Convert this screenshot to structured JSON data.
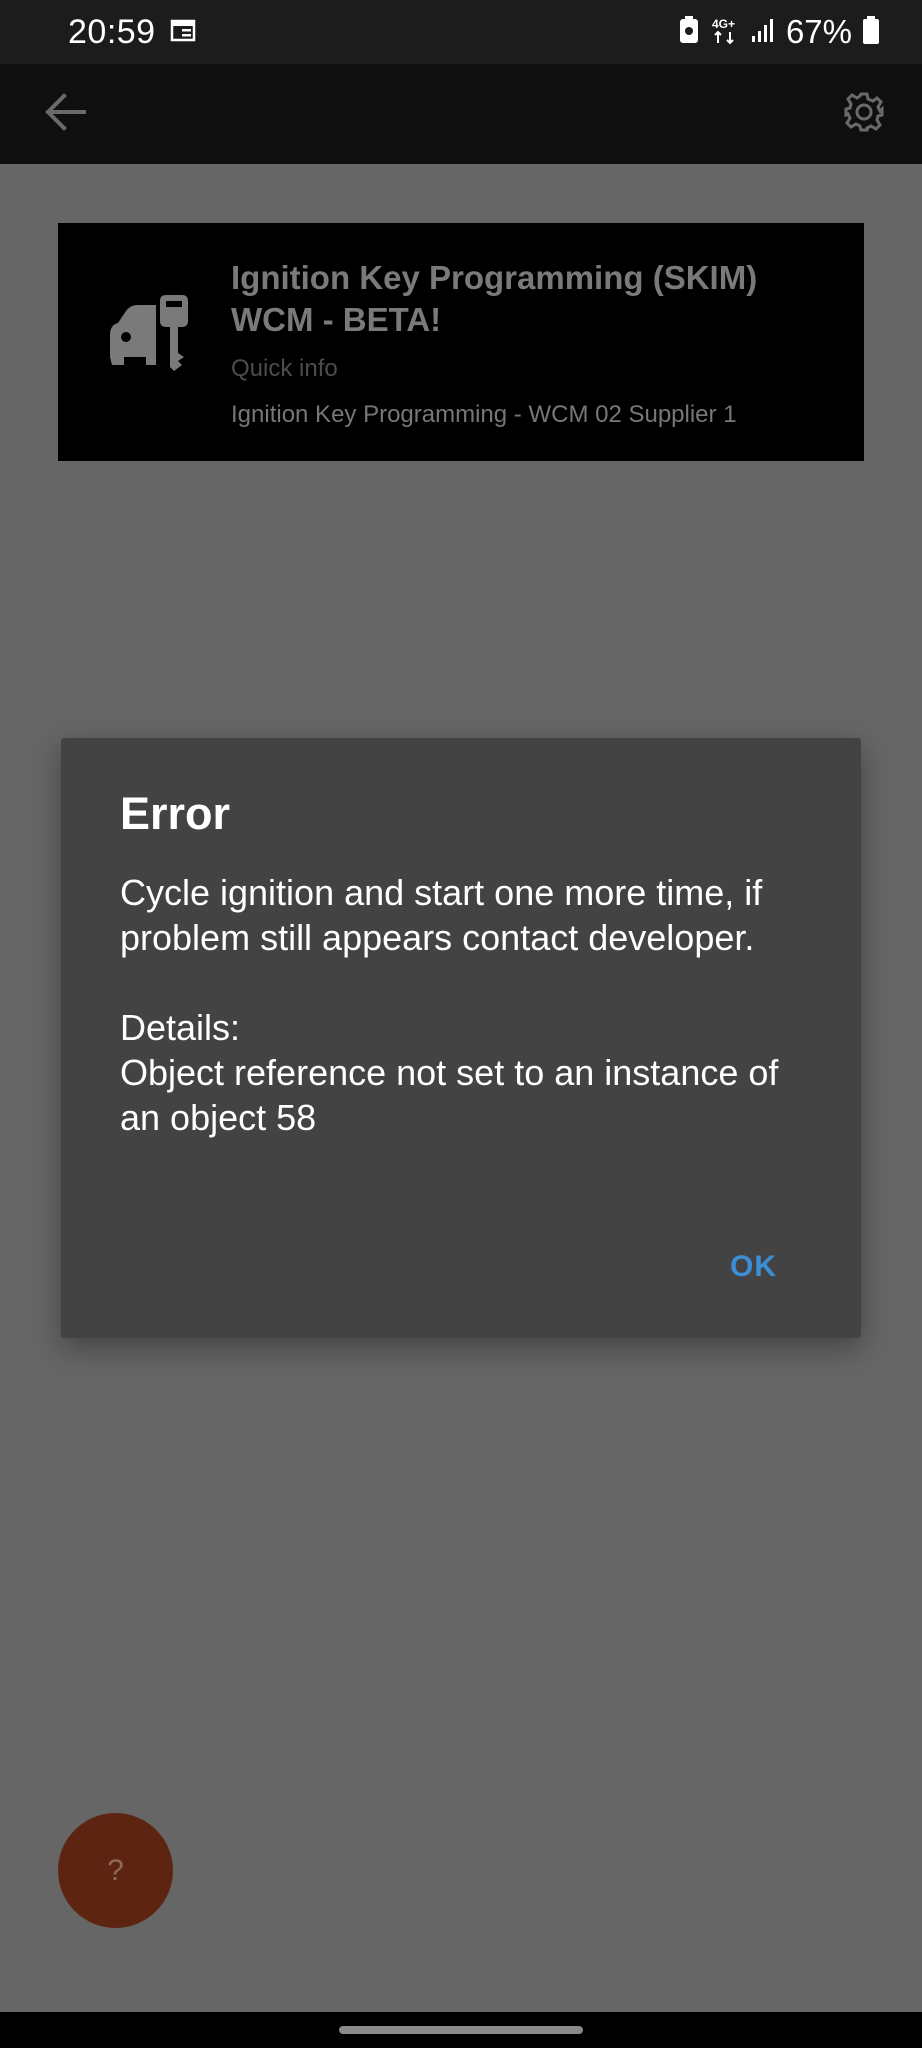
{
  "status_bar": {
    "time": "20:59",
    "network": "4G+",
    "battery_percent": "67%",
    "icons": [
      "calendar-icon",
      "battery-saver-icon",
      "network-4g-icon",
      "signal-icon",
      "battery-icon"
    ]
  },
  "toolbar": {
    "back_icon": "arrow-left-icon",
    "settings_icon": "gear-icon"
  },
  "function_card": {
    "icon": "car-key-icon",
    "title": "Ignition Key Programming (SKIM) WCM - BETA!",
    "quick_info_label": "Quick info",
    "description": "Ignition Key Programming - WCM 02 Supplier 1"
  },
  "dialog": {
    "title": "Error",
    "message": "Cycle ignition and start one more time, if problem still appears contact developer.\n\nDetails:\nObject reference not set to an instance of an object 58",
    "ok_label": "OK"
  },
  "help_button": {
    "label": "?"
  },
  "colors": {
    "background_dimmed": "#666666",
    "toolbar": "#0f0f0f",
    "dialog": "#434343",
    "accent": "#3b8fd6",
    "fab": "#5e2412"
  }
}
